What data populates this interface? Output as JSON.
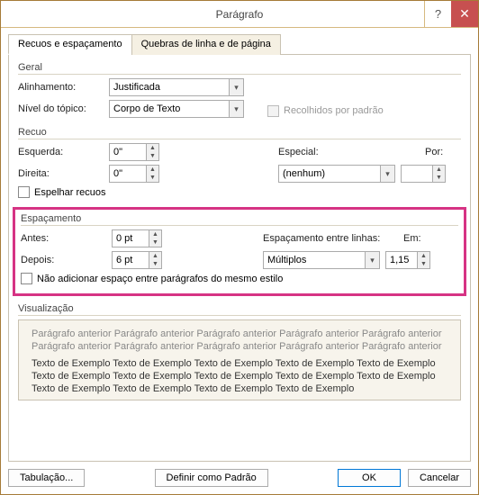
{
  "window": {
    "title": "Parágrafo"
  },
  "tabs": {
    "indent": "Recuos e espaçamento",
    "breaks": "Quebras de linha e de página"
  },
  "general": {
    "title": "Geral",
    "alignment_label": "Alinhamento:",
    "alignment_value": "Justificada",
    "outline_label": "Nível do tópico:",
    "outline_value": "Corpo de Texto",
    "collapsed_label": "Recolhidos por padrão"
  },
  "indent": {
    "title": "Recuo",
    "left_label": "Esquerda:",
    "left_value": "0\"",
    "right_label": "Direita:",
    "right_value": "0\"",
    "special_label": "Especial:",
    "special_value": "(nenhum)",
    "by_label": "Por:",
    "by_value": "",
    "mirror_label": "Espelhar recuos"
  },
  "spacing": {
    "title": "Espaçamento",
    "before_label": "Antes:",
    "before_value": "0 pt",
    "after_label": "Depois:",
    "after_value": "6 pt",
    "line_label": "Espaçamento entre linhas:",
    "line_value": "Múltiplos",
    "at_label": "Em:",
    "at_value": "1,15",
    "nospace_label": "Não adicionar espaço entre parágrafos do mesmo estilo"
  },
  "preview": {
    "title": "Visualização",
    "prev_text": "Parágrafo anterior Parágrafo anterior Parágrafo anterior Parágrafo anterior Parágrafo anterior Parágrafo anterior Parágrafo anterior Parágrafo anterior Parágrafo anterior Parágrafo anterior",
    "sample_text": "Texto de Exemplo Texto de Exemplo Texto de Exemplo Texto de Exemplo Texto de Exemplo Texto de Exemplo Texto de Exemplo Texto de Exemplo Texto de Exemplo Texto de Exemplo Texto de Exemplo Texto de Exemplo Texto de Exemplo Texto de Exemplo"
  },
  "buttons": {
    "tabs": "Tabulação...",
    "default": "Definir como Padrão",
    "ok": "OK",
    "cancel": "Cancelar"
  }
}
